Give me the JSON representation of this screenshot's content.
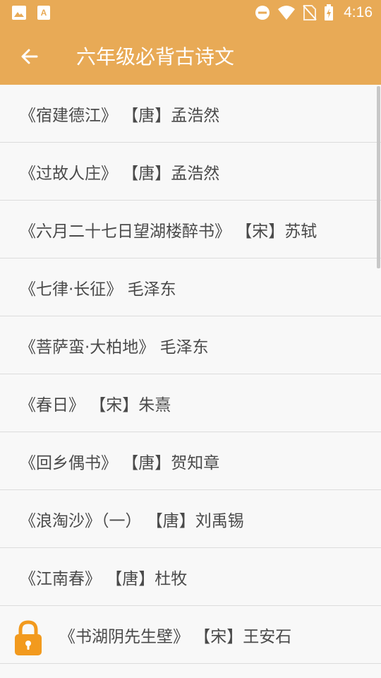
{
  "status_bar": {
    "time": "4:16"
  },
  "toolbar": {
    "title": "六年级必背古诗文"
  },
  "poems": [
    {
      "label": "《宿建德江》 【唐】孟浩然",
      "locked": false
    },
    {
      "label": "《过故人庄》 【唐】孟浩然",
      "locked": false
    },
    {
      "label": "《六月二十七日望湖楼醉书》 【宋】苏轼",
      "locked": false
    },
    {
      "label": "《七律·长征》 毛泽东",
      "locked": false
    },
    {
      "label": "《菩萨蛮·大柏地》 毛泽东",
      "locked": false
    },
    {
      "label": "《春日》 【宋】朱熹",
      "locked": false
    },
    {
      "label": "《回乡偶书》 【唐】贺知章",
      "locked": false
    },
    {
      "label": "《浪淘沙》（一） 【唐】刘禹锡",
      "locked": false
    },
    {
      "label": "《江南春》 【唐】杜牧",
      "locked": false
    },
    {
      "label": "《书湖阴先生壁》 【宋】王安石",
      "locked": true
    }
  ],
  "colors": {
    "accent": "#e8aa56",
    "lock": "#f29a1e"
  }
}
